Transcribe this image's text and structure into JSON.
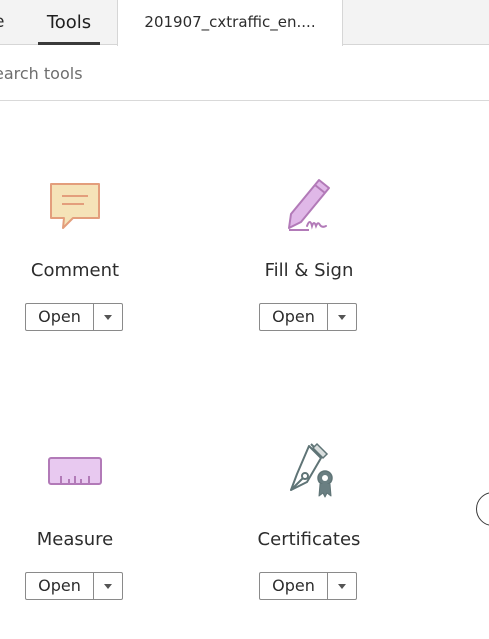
{
  "tabs": {
    "home_partial": "e",
    "tools": "Tools",
    "document": "201907_cxtraffic_en...."
  },
  "search": {
    "placeholder": "earch tools"
  },
  "tools": [
    {
      "name": "Comment",
      "icon": "comment-icon",
      "open_label": "Open",
      "color": "#f5e3b8"
    },
    {
      "name": "Fill & Sign",
      "icon": "fill-sign-pen-icon",
      "open_label": "Open",
      "color": "#e0b8e8"
    },
    {
      "name": "Measure",
      "icon": "ruler-icon",
      "open_label": "Open",
      "color": "#e8c9f0"
    },
    {
      "name": "Certificates",
      "icon": "certificate-pen-icon",
      "open_label": "Open",
      "color": "#6a7f82"
    }
  ]
}
